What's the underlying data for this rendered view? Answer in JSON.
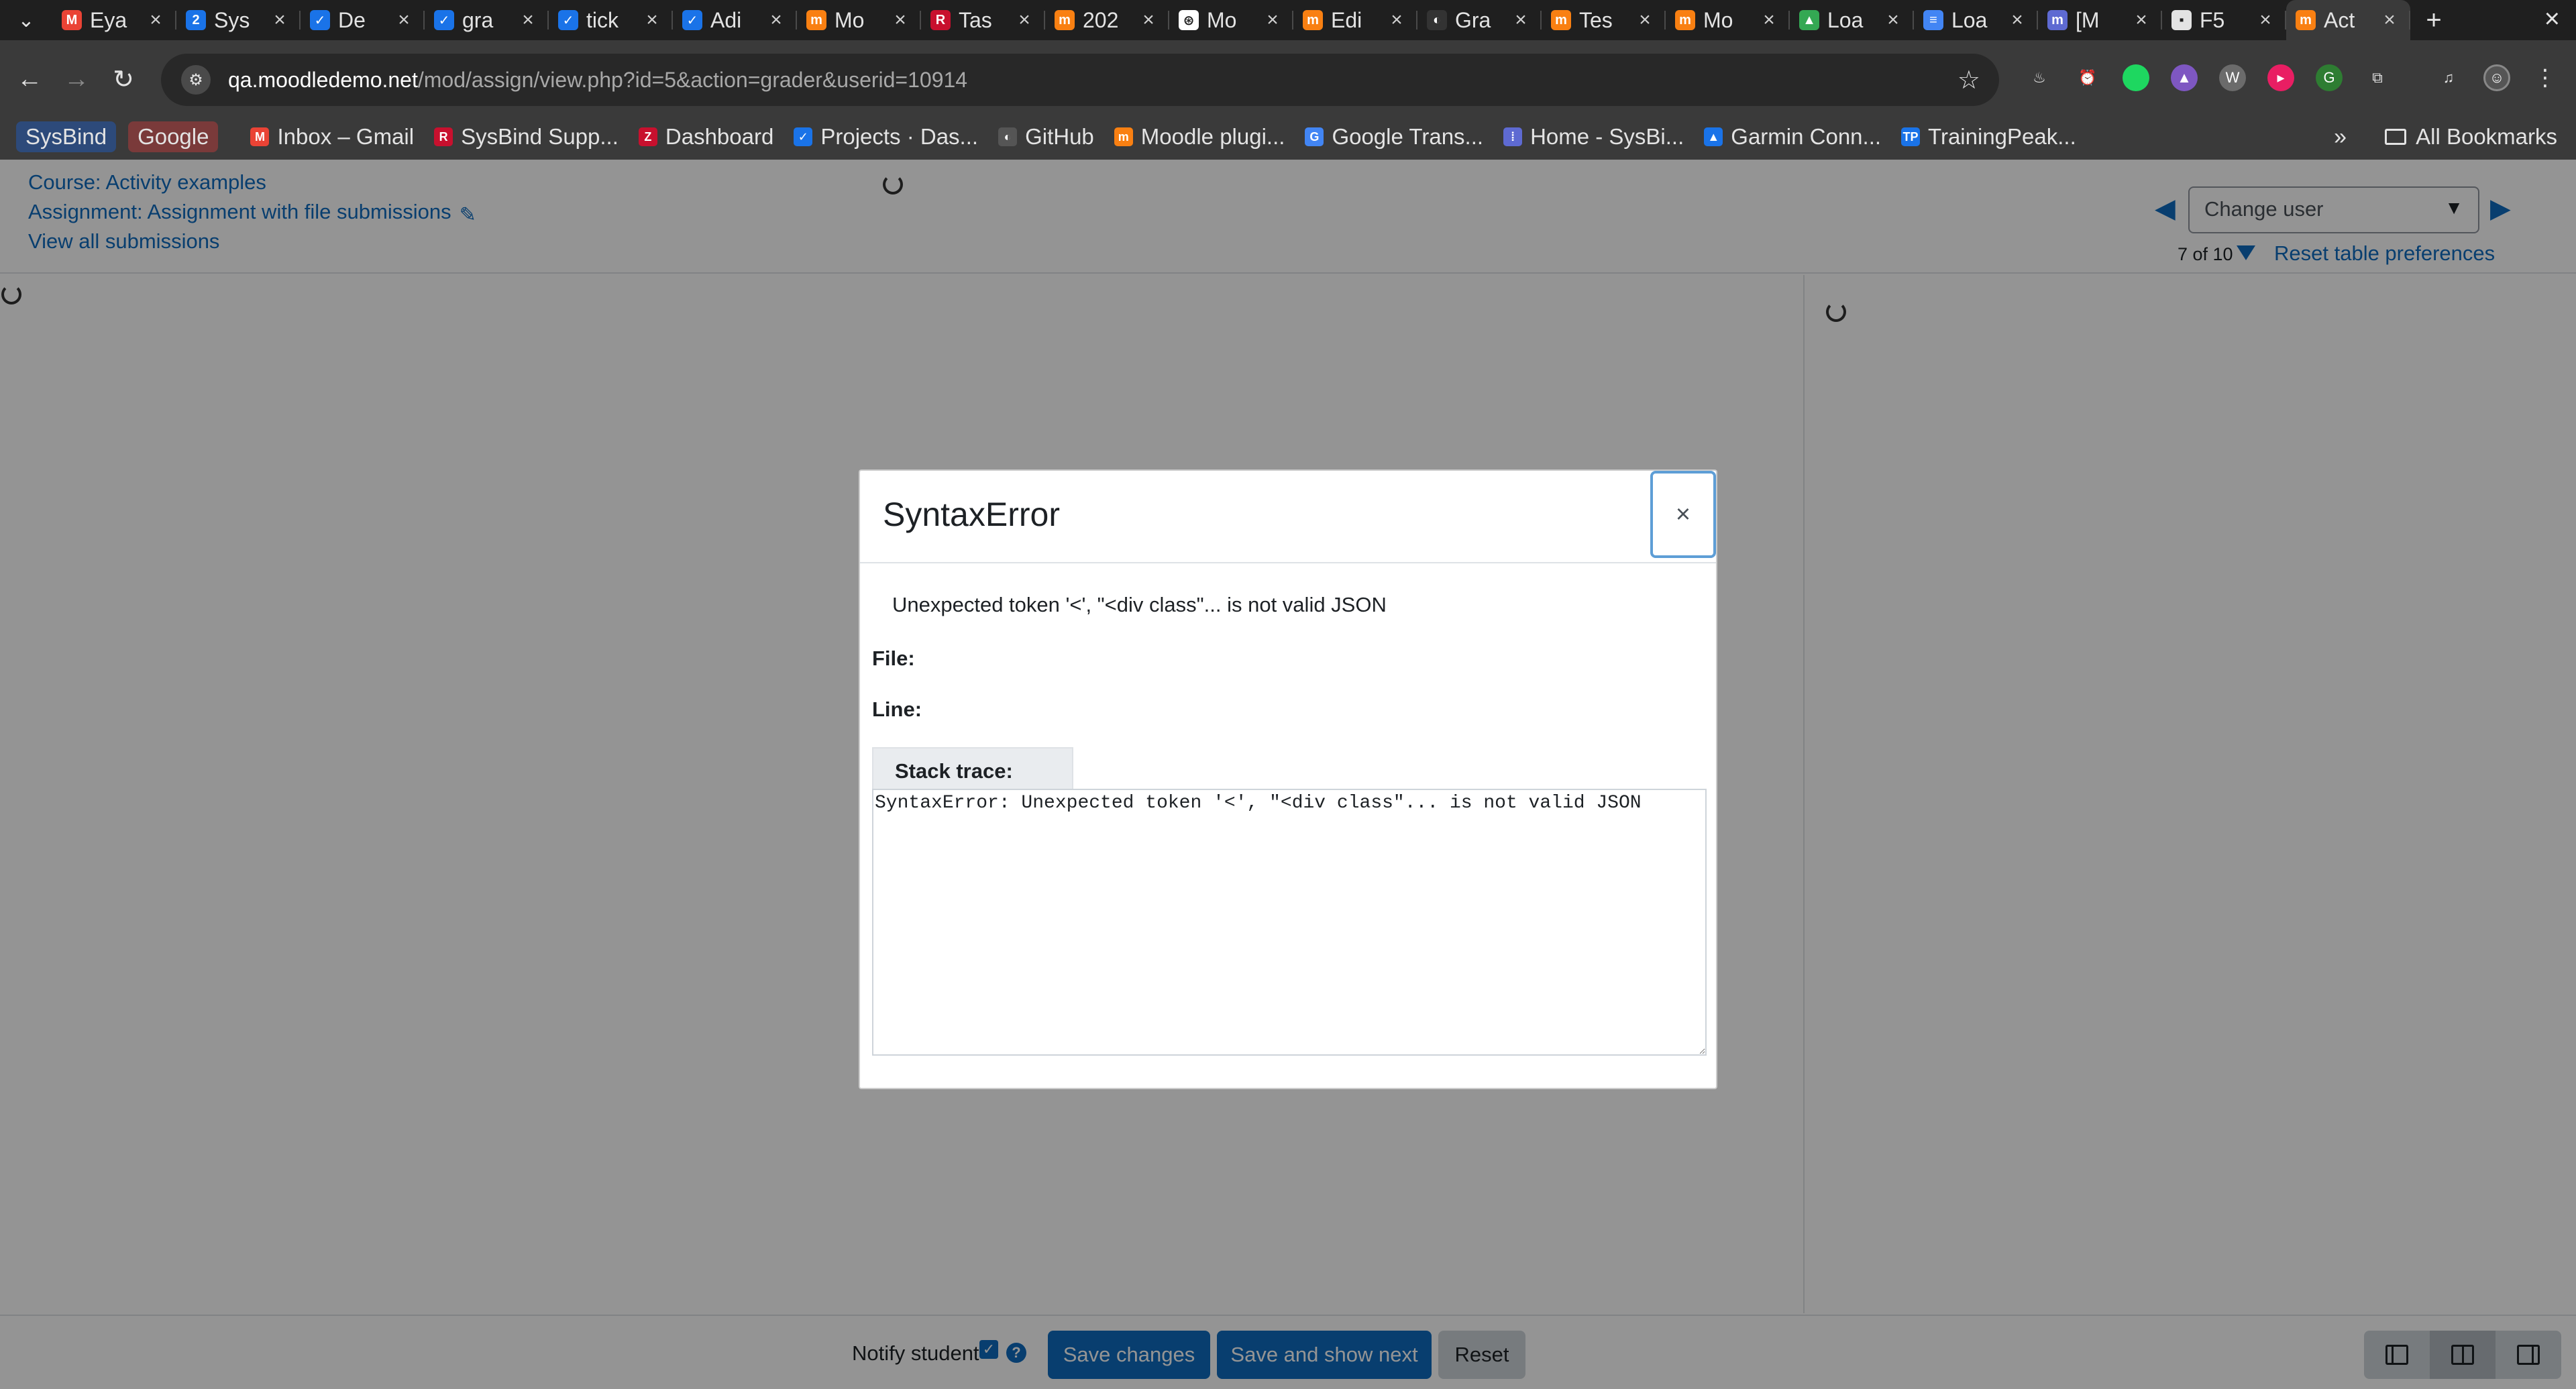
{
  "browser": {
    "tabs": [
      {
        "title": "Eya",
        "icon": "gmail-icon",
        "color": "#ea4335",
        "glyph": "M"
      },
      {
        "title": "Sys",
        "icon": "sysbind-icon",
        "color": "#1a73e8",
        "glyph": "2"
      },
      {
        "title": "De",
        "icon": "gitlab-icon",
        "color": "#1a73e8",
        "glyph": "✓"
      },
      {
        "title": "gra",
        "icon": "gitlab-icon",
        "color": "#1a73e8",
        "glyph": "✓"
      },
      {
        "title": "tick",
        "icon": "ticket-icon",
        "color": "#1a73e8",
        "glyph": "✓"
      },
      {
        "title": "Adi",
        "icon": "admin-icon",
        "color": "#1a73e8",
        "glyph": "✓"
      },
      {
        "title": "Mo",
        "icon": "moodle-icon",
        "color": "#f98012",
        "glyph": "m"
      },
      {
        "title": "Tas",
        "icon": "redmine-icon",
        "color": "#c8102e",
        "glyph": "R"
      },
      {
        "title": "202",
        "icon": "moodle-hat-icon",
        "color": "#f98012",
        "glyph": "m"
      },
      {
        "title": "Mo",
        "icon": "openai-icon",
        "color": "#ffffff",
        "glyph": "⊛"
      },
      {
        "title": "Edi",
        "icon": "moodle-hat-icon",
        "color": "#f98012",
        "glyph": "m"
      },
      {
        "title": "Gra",
        "icon": "github-icon",
        "color": "#333333",
        "glyph": "◐"
      },
      {
        "title": "Tes",
        "icon": "moodle-hat-icon",
        "color": "#f98012",
        "glyph": "m"
      },
      {
        "title": "Mo",
        "icon": "moodle-icon",
        "color": "#f98012",
        "glyph": "m"
      },
      {
        "title": "Loa",
        "icon": "drive-icon",
        "color": "#34a853",
        "glyph": "▲"
      },
      {
        "title": "Loa",
        "icon": "docs-icon",
        "color": "#4285f4",
        "glyph": "≡"
      },
      {
        "title": "[M",
        "icon": "moodle-m-icon",
        "color": "#5e6ad2",
        "glyph": "m"
      },
      {
        "title": "F5",
        "icon": "file-icon",
        "color": "#e3e3e3",
        "glyph": "▪"
      },
      {
        "title": "Act",
        "icon": "moodle-hat-icon",
        "color": "#f98012",
        "glyph": "m",
        "active": true
      }
    ],
    "url_host": "qa.moodledemo.net",
    "url_path": "/mod/assign/view.php?id=5&action=grader&userid=10914",
    "bookmarks": [
      {
        "label": "Inbox – Gmail",
        "icon": "gmail-icon",
        "color": "#ea4335",
        "glyph": "M"
      },
      {
        "label": "SysBind Supp...",
        "icon": "redmine-icon",
        "color": "#c8102e",
        "glyph": "R"
      },
      {
        "label": "Dashboard",
        "icon": "zendesk-icon",
        "color": "#c8102e",
        "glyph": "Z"
      },
      {
        "label": "Projects · Das...",
        "icon": "gitlab-icon",
        "color": "#1a73e8",
        "glyph": "✓"
      },
      {
        "label": "GitHub",
        "icon": "github-icon",
        "color": "#555555",
        "glyph": "◐"
      },
      {
        "label": "Moodle plugi...",
        "icon": "moodle-icon",
        "color": "#f98012",
        "glyph": "m"
      },
      {
        "label": "Google Trans...",
        "icon": "translate-icon",
        "color": "#4285f4",
        "glyph": "G"
      },
      {
        "label": "Home - SysBi...",
        "icon": "grid-icon",
        "color": "#5e6ad2",
        "glyph": "⁞"
      },
      {
        "label": "Garmin Conn...",
        "icon": "garmin-icon",
        "color": "#1a73e8",
        "glyph": "▲"
      },
      {
        "label": "TrainingPeak...",
        "icon": "trainingpeaks-icon",
        "color": "#1a73e8",
        "glyph": "TP"
      }
    ],
    "bookmark_chips": [
      {
        "label": "SysBind",
        "bg": "#2d4a7a",
        "color": "#e3e3e3"
      },
      {
        "label": "Google",
        "bg": "#7a3a3a",
        "color": "#e3e3e3"
      }
    ],
    "all_bookmarks": "All Bookmarks",
    "more": "»"
  },
  "header": {
    "course_link": "Course: Activity examples",
    "assignment_link": "Assignment: Assignment with file submissions",
    "view_all": "View all submissions",
    "change_user_placeholder": "Change user",
    "count": "7 of 10",
    "reset_prefs": "Reset table preferences"
  },
  "footer": {
    "notify_label": "Notify student",
    "save_changes": "Save changes",
    "save_next": "Save and show next",
    "reset": "Reset"
  },
  "modal": {
    "title": "SyntaxError",
    "message": "Unexpected token '<', \"<div class\"... is not valid JSON",
    "file_label": "File:",
    "line_label": "Line:",
    "stack_label": "Stack trace:",
    "stack_trace": "SyntaxError: Unexpected token '<', \"<div class\"... is not valid JSON",
    "close_glyph": "×"
  },
  "colors": {
    "brand": "#0f6cbf",
    "chrome_dark": "#1f1f1f",
    "chrome_mid": "#3a3a3a"
  }
}
